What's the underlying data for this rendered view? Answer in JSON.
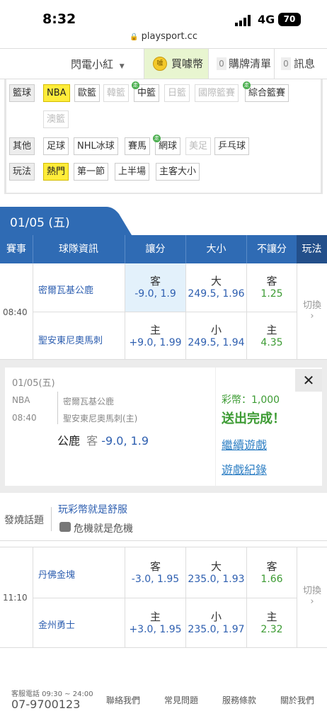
{
  "status": {
    "time": "8:32",
    "network": "4G",
    "battery": "70",
    "url": "playsport.cc"
  },
  "nav": {
    "user": "閃電小紅",
    "buy_label": "買噱幣",
    "coin_glyph": "噱",
    "cart_count": "0",
    "cart_label": "購牌清單",
    "msg_count": "0",
    "msg_label": "訊息"
  },
  "filter": {
    "basketball_label": "籃球",
    "basketball": [
      "NBA",
      "歐籃",
      "韓籃",
      "中籃",
      "日籃",
      "國際籃賽",
      "綜合籃賽",
      "澳籃"
    ],
    "other_label": "其他",
    "other": [
      "足球",
      "NHL冰球",
      "賽馬",
      "網球",
      "美足",
      "乒乓球"
    ],
    "play_label": "玩法",
    "play": [
      "熱門",
      "第一節",
      "上半場",
      "主客大小"
    ],
    "walk_glyph": "走"
  },
  "date": "01/05 (五)",
  "columns": {
    "event": "賽事",
    "team": "球隊資訊",
    "spread": "讓分",
    "total": "大小",
    "moneyline": "不讓分",
    "play": "玩法"
  },
  "games": [
    {
      "time": "08:40",
      "switch": "切換",
      "away": {
        "team": "密爾瓦基公鹿",
        "spread_side": "客",
        "spread": "-9.0, 1.9",
        "total_side": "大",
        "total": "249.5, 1.96",
        "ml_side": "客",
        "ml": "1.25"
      },
      "home": {
        "team": "聖安東尼奧馬刺",
        "spread_side": "主",
        "spread": "+9.0, 1.99",
        "total_side": "小",
        "total": "249.5, 1.94",
        "ml_side": "主",
        "ml": "4.35"
      }
    },
    {
      "time": "11:10",
      "switch": "切換",
      "away": {
        "team": "丹佛金塊",
        "spread_side": "客",
        "spread": "-3.0, 1.95",
        "total_side": "大",
        "total": "235.0, 1.93",
        "ml_side": "客",
        "ml": "1.66"
      },
      "home": {
        "team": "金州勇士",
        "spread_side": "主",
        "spread": "+3.0, 1.95",
        "total_side": "小",
        "total": "235.0, 1.97",
        "ml_side": "主",
        "ml": "2.32"
      }
    }
  ],
  "popup": {
    "date": "01/05(五)",
    "league": "NBA",
    "time": "08:40",
    "team1": "密爾瓦基公鹿",
    "team2": "聖安東尼奧馬刺(主)",
    "pick_team": "公鹿",
    "pick_side": "客",
    "pick_value": "-9.0, 1.9",
    "coins": "彩幣：1,000",
    "success": "送出完成！",
    "continue": "繼續遊戲",
    "history": "遊戲紀錄",
    "close": "✕"
  },
  "hot": {
    "label": "發燒話題",
    "title": "玩彩幣就是舒服",
    "sub": "危機就是危機"
  },
  "footer": {
    "service": "客服電話 09:30 ~ 24:00",
    "phone": "07-9700123",
    "links": [
      "聯絡我們",
      "常見問題",
      "服務條款",
      "關於我們"
    ]
  },
  "colors": {
    "header_blue": "#2f6bb4",
    "selected_yellow": "#ffec3a",
    "value_blue": "#2e5fb0",
    "value_green": "#3c9b33",
    "success_green": "#3c9b33"
  }
}
